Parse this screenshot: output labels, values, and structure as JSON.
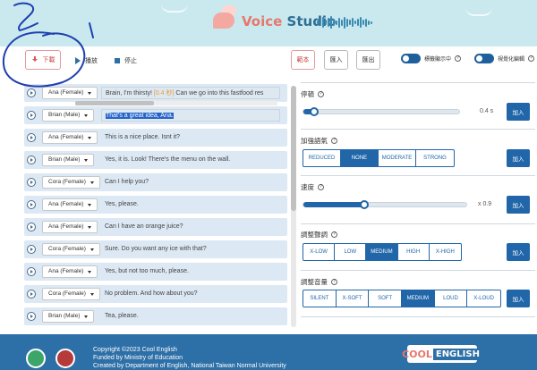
{
  "header": {
    "brand_part1": "Voice",
    "brand_part2": "Studio"
  },
  "toolbar": {
    "download_label": "下載",
    "play_label": "播放",
    "stop_label": "停止",
    "sample_label": "範本",
    "import_label": "匯入",
    "export_label": "匯出",
    "toggle1_label": "標籤顯示中",
    "toggle2_label": "視覺化編輯"
  },
  "dialogue": {
    "lines": [
      {
        "speaker": "Ana (Female)",
        "text": "Brain, I'm thirsty! ",
        "tag": "[0.4 秒]",
        "rest": " Can we go into this fastfood res"
      },
      {
        "speaker": "Brian (Male)",
        "text": "That's a great idea, Ana."
      },
      {
        "speaker": "Ana (Female)",
        "text": "This is a nice place.  Isnt it?"
      },
      {
        "speaker": "Brian (Male)",
        "text": "Yes, it is. Look! There's the menu on the wall."
      },
      {
        "speaker": "Cora (Female)",
        "text": "Can I help you?"
      },
      {
        "speaker": "Ana (Female)",
        "text": "Yes, please."
      },
      {
        "speaker": "Ana (Female)",
        "text": "Can I have an orange juice?"
      },
      {
        "speaker": "Cora (Female)",
        "text": "Sure. Do you want any ice with that?"
      },
      {
        "speaker": "Ana (Female)",
        "text": "Yes, but not too much, please."
      },
      {
        "speaker": "Cora (Female)",
        "text": "No problem. And how about you?"
      },
      {
        "speaker": "Brian (Male)",
        "text": "Tea, please."
      }
    ]
  },
  "panel": {
    "pause": {
      "title": "停頓",
      "value": 0.4,
      "display": "0.4 s",
      "add_label": "加入"
    },
    "emphasis": {
      "title": "加強語氣",
      "options": [
        "REDUCED",
        "NONE",
        "MODERATE",
        "STRONG"
      ],
      "selected": "NONE",
      "add_label": "加入"
    },
    "rate": {
      "title": "速度",
      "value": 0.9,
      "display": "x 0.9",
      "add_label": "加入"
    },
    "pitch": {
      "title": "調整聲調",
      "options": [
        "X-LOW",
        "LOW",
        "MEDIUM",
        "HIGH",
        "X-HIGH"
      ],
      "selected": "MEDIUM",
      "add_label": "加入"
    },
    "volume": {
      "title": "調整音量",
      "options": [
        "SILENT",
        "X-SOFT",
        "SOFT",
        "MEDIUM",
        "LOUD",
        "X-LOUD"
      ],
      "selected": "MEDIUM",
      "add_label": "加入"
    }
  },
  "footer": {
    "line1": "Copyright ©2023 Cool English",
    "line2": "Funded by Ministry of Education",
    "line3": "Created by Department of English, National Taiwan Normal University",
    "logo_part1": "COOL",
    "logo_part2": "ENGLISH"
  },
  "colors": {
    "accent": "#2166a8",
    "header_bg": "#c9e9ef",
    "footer_bg": "#2d6fa7",
    "brand_coral": "#e8776b"
  }
}
